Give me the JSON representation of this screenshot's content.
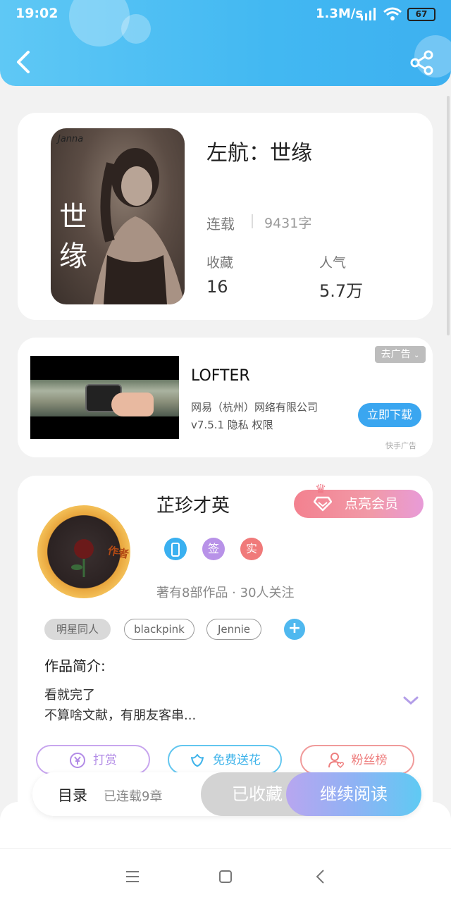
{
  "status_bar": {
    "time": "19:02",
    "network": "1.3M/s",
    "battery": "67"
  },
  "book": {
    "title": "左航：世缘",
    "cover_text": "世缘",
    "cover_small_text": "Janna",
    "status": "连载",
    "words": "9431字",
    "favorites_label": "收藏",
    "favorites_value": "16",
    "popularity_label": "人气",
    "popularity_value": "5.7万"
  },
  "ad": {
    "skip_label": "去广告",
    "app_name": "LOFTER",
    "company": "网易（杭州）网络有限公司",
    "version_line": "v7.5.1  隐私  权限",
    "download_label": "立即下载",
    "source": "快手广告"
  },
  "author": {
    "name": "芷珍才英",
    "avatar_badge": "作者",
    "vip_label": "点亮会员",
    "badges": [
      {
        "label": "",
        "color": "#3ab0f0"
      },
      {
        "label": "签",
        "color": "#b892e8"
      },
      {
        "label": "实",
        "color": "#f07a7a"
      }
    ],
    "stats": "著有8部作品 · 30人关注",
    "tags": [
      "明星同人",
      "blackpink",
      "Jennie"
    ],
    "tag_add": "+"
  },
  "intro": {
    "title": "作品简介:",
    "line1": "看就完了",
    "line2": "不算啥文献，有朋友客串..."
  },
  "actions": {
    "tip_label": "打赏",
    "flower_label": "免费送花",
    "fans_label": "粉丝榜"
  },
  "bottom_bar": {
    "toc_label": "目录",
    "toc_progress": "已连载9章",
    "collected_label": "已收藏",
    "read_label": "继续阅读"
  },
  "colors": {
    "header_blue": "#42b8f2",
    "accent_blue": "#3aa6f0",
    "vip_pink": "#f3818f",
    "read_gradient_start": "#b8a6f0",
    "read_gradient_end": "#5fcaf3"
  }
}
